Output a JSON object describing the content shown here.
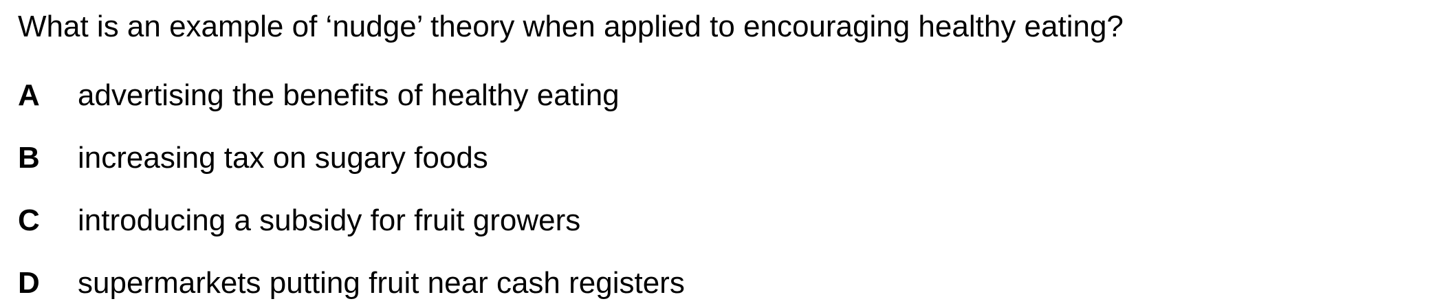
{
  "question": "What is an example of ‘nudge’ theory when applied to encouraging healthy eating?",
  "options": [
    {
      "letter": "A",
      "text": "advertising the benefits of healthy eating"
    },
    {
      "letter": "B",
      "text": "increasing tax on sugary foods"
    },
    {
      "letter": "C",
      "text": "introducing a subsidy for fruit growers"
    },
    {
      "letter": "D",
      "text": "supermarkets putting fruit near cash registers"
    }
  ]
}
